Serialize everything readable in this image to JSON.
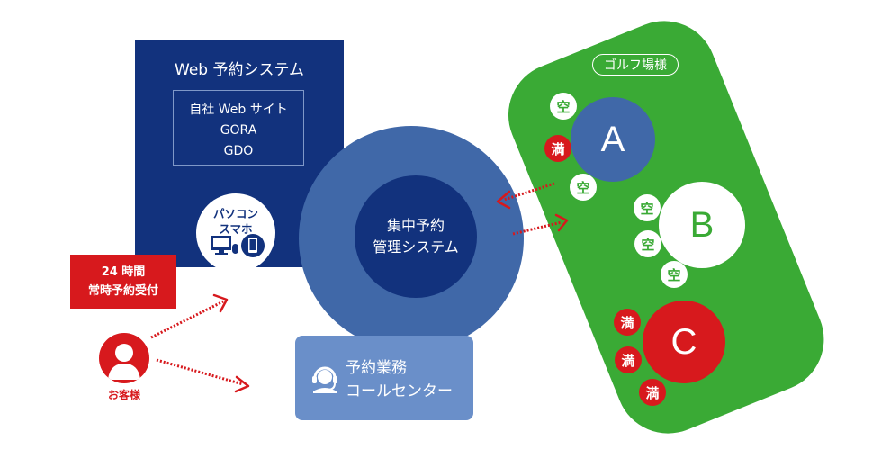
{
  "web_system": {
    "title": "Web 予約システム",
    "sites": [
      "自社 Web サイト",
      "GORA",
      "GDO"
    ],
    "devices_label_line1": "パソコン",
    "devices_label_line2": "スマホ"
  },
  "reception": {
    "line1": "24 時間",
    "line2": "常時予約受付"
  },
  "customer": {
    "label": "お客様"
  },
  "hub": {
    "line1": "集中予約",
    "line2": "管理システム"
  },
  "call_center": {
    "line1": "予約業務",
    "line2": "コールセンター"
  },
  "golf": {
    "title": "ゴルフ場様",
    "courses": [
      {
        "name": "A",
        "slots": [
          "空",
          "満",
          "空"
        ]
      },
      {
        "name": "B",
        "slots": [
          "空",
          "空",
          "空"
        ]
      },
      {
        "name": "C",
        "slots": [
          "満",
          "満",
          "満"
        ]
      }
    ]
  },
  "colors": {
    "navy": "#12327d",
    "hub_blue": "#4068a8",
    "call_blue": "#6a8fc9",
    "red": "#d7191d",
    "green": "#3aaa35"
  },
  "icons": [
    "monitor-icon",
    "mouse-icon",
    "smartphone-icon",
    "person-icon",
    "headset-icon"
  ]
}
